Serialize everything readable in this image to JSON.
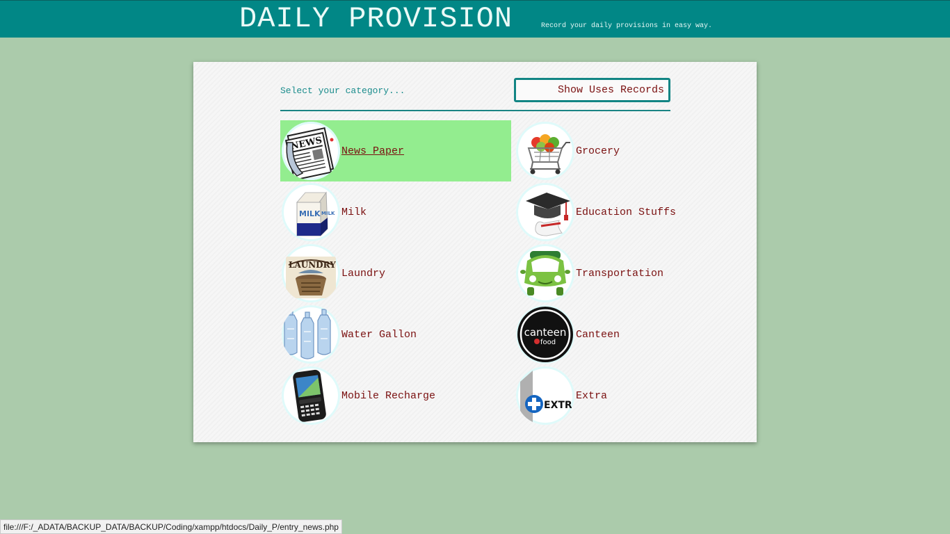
{
  "header": {
    "title": "DAILY PROVISION",
    "tagline": "Record your daily provisions in easy way."
  },
  "panel": {
    "select_label": "Select your category...",
    "records_button": "Show Uses Records"
  },
  "categories": [
    {
      "label": "News Paper",
      "icon": "newspaper-icon",
      "active": true
    },
    {
      "label": "Grocery",
      "icon": "grocery-cart-icon",
      "active": false
    },
    {
      "label": "Milk",
      "icon": "milk-carton-icon",
      "active": false
    },
    {
      "label": "Education Stuffs",
      "icon": "graduation-cap-icon",
      "active": false
    },
    {
      "label": "Laundry",
      "icon": "laundry-basket-icon",
      "active": false
    },
    {
      "label": "Transportation",
      "icon": "car-icon",
      "active": false
    },
    {
      "label": "Water Gallon",
      "icon": "water-gallon-icon",
      "active": false
    },
    {
      "label": "Canteen",
      "icon": "canteen-food-icon",
      "active": false,
      "logo_text": "canteen",
      "logo_subtext": "food"
    },
    {
      "label": "Mobile Recharge",
      "icon": "mobile-phone-icon",
      "active": false
    },
    {
      "label": "Extra",
      "icon": "extra-plus-icon",
      "active": false,
      "logo_text": "EXTRA"
    }
  ],
  "status_bar": {
    "url": "file:///F:/_ADATA/BACKUP_DATA/BACKUP/Coding/xampp/htdocs/Daily_P/entry_news.php"
  },
  "colors": {
    "header_bg": "#018786",
    "page_bg": "#abcbab",
    "active_item_bg": "#93ed8f",
    "item_text": "#7a1010",
    "accent": "#128584"
  }
}
